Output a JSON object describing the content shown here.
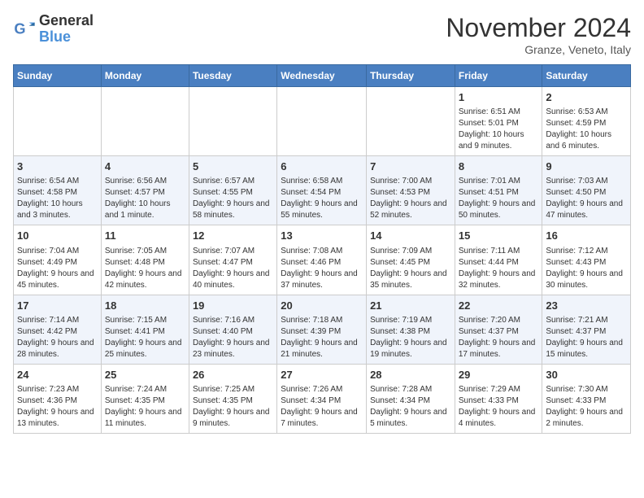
{
  "logo": {
    "line1": "General",
    "line2": "Blue"
  },
  "title": "November 2024",
  "location": "Granze, Veneto, Italy",
  "days_of_week": [
    "Sunday",
    "Monday",
    "Tuesday",
    "Wednesday",
    "Thursday",
    "Friday",
    "Saturday"
  ],
  "weeks": [
    [
      {
        "day": "",
        "info": ""
      },
      {
        "day": "",
        "info": ""
      },
      {
        "day": "",
        "info": ""
      },
      {
        "day": "",
        "info": ""
      },
      {
        "day": "",
        "info": ""
      },
      {
        "day": "1",
        "info": "Sunrise: 6:51 AM\nSunset: 5:01 PM\nDaylight: 10 hours and 9 minutes."
      },
      {
        "day": "2",
        "info": "Sunrise: 6:53 AM\nSunset: 4:59 PM\nDaylight: 10 hours and 6 minutes."
      }
    ],
    [
      {
        "day": "3",
        "info": "Sunrise: 6:54 AM\nSunset: 4:58 PM\nDaylight: 10 hours and 3 minutes."
      },
      {
        "day": "4",
        "info": "Sunrise: 6:56 AM\nSunset: 4:57 PM\nDaylight: 10 hours and 1 minute."
      },
      {
        "day": "5",
        "info": "Sunrise: 6:57 AM\nSunset: 4:55 PM\nDaylight: 9 hours and 58 minutes."
      },
      {
        "day": "6",
        "info": "Sunrise: 6:58 AM\nSunset: 4:54 PM\nDaylight: 9 hours and 55 minutes."
      },
      {
        "day": "7",
        "info": "Sunrise: 7:00 AM\nSunset: 4:53 PM\nDaylight: 9 hours and 52 minutes."
      },
      {
        "day": "8",
        "info": "Sunrise: 7:01 AM\nSunset: 4:51 PM\nDaylight: 9 hours and 50 minutes."
      },
      {
        "day": "9",
        "info": "Sunrise: 7:03 AM\nSunset: 4:50 PM\nDaylight: 9 hours and 47 minutes."
      }
    ],
    [
      {
        "day": "10",
        "info": "Sunrise: 7:04 AM\nSunset: 4:49 PM\nDaylight: 9 hours and 45 minutes."
      },
      {
        "day": "11",
        "info": "Sunrise: 7:05 AM\nSunset: 4:48 PM\nDaylight: 9 hours and 42 minutes."
      },
      {
        "day": "12",
        "info": "Sunrise: 7:07 AM\nSunset: 4:47 PM\nDaylight: 9 hours and 40 minutes."
      },
      {
        "day": "13",
        "info": "Sunrise: 7:08 AM\nSunset: 4:46 PM\nDaylight: 9 hours and 37 minutes."
      },
      {
        "day": "14",
        "info": "Sunrise: 7:09 AM\nSunset: 4:45 PM\nDaylight: 9 hours and 35 minutes."
      },
      {
        "day": "15",
        "info": "Sunrise: 7:11 AM\nSunset: 4:44 PM\nDaylight: 9 hours and 32 minutes."
      },
      {
        "day": "16",
        "info": "Sunrise: 7:12 AM\nSunset: 4:43 PM\nDaylight: 9 hours and 30 minutes."
      }
    ],
    [
      {
        "day": "17",
        "info": "Sunrise: 7:14 AM\nSunset: 4:42 PM\nDaylight: 9 hours and 28 minutes."
      },
      {
        "day": "18",
        "info": "Sunrise: 7:15 AM\nSunset: 4:41 PM\nDaylight: 9 hours and 25 minutes."
      },
      {
        "day": "19",
        "info": "Sunrise: 7:16 AM\nSunset: 4:40 PM\nDaylight: 9 hours and 23 minutes."
      },
      {
        "day": "20",
        "info": "Sunrise: 7:18 AM\nSunset: 4:39 PM\nDaylight: 9 hours and 21 minutes."
      },
      {
        "day": "21",
        "info": "Sunrise: 7:19 AM\nSunset: 4:38 PM\nDaylight: 9 hours and 19 minutes."
      },
      {
        "day": "22",
        "info": "Sunrise: 7:20 AM\nSunset: 4:37 PM\nDaylight: 9 hours and 17 minutes."
      },
      {
        "day": "23",
        "info": "Sunrise: 7:21 AM\nSunset: 4:37 PM\nDaylight: 9 hours and 15 minutes."
      }
    ],
    [
      {
        "day": "24",
        "info": "Sunrise: 7:23 AM\nSunset: 4:36 PM\nDaylight: 9 hours and 13 minutes."
      },
      {
        "day": "25",
        "info": "Sunrise: 7:24 AM\nSunset: 4:35 PM\nDaylight: 9 hours and 11 minutes."
      },
      {
        "day": "26",
        "info": "Sunrise: 7:25 AM\nSunset: 4:35 PM\nDaylight: 9 hours and 9 minutes."
      },
      {
        "day": "27",
        "info": "Sunrise: 7:26 AM\nSunset: 4:34 PM\nDaylight: 9 hours and 7 minutes."
      },
      {
        "day": "28",
        "info": "Sunrise: 7:28 AM\nSunset: 4:34 PM\nDaylight: 9 hours and 5 minutes."
      },
      {
        "day": "29",
        "info": "Sunrise: 7:29 AM\nSunset: 4:33 PM\nDaylight: 9 hours and 4 minutes."
      },
      {
        "day": "30",
        "info": "Sunrise: 7:30 AM\nSunset: 4:33 PM\nDaylight: 9 hours and 2 minutes."
      }
    ]
  ]
}
